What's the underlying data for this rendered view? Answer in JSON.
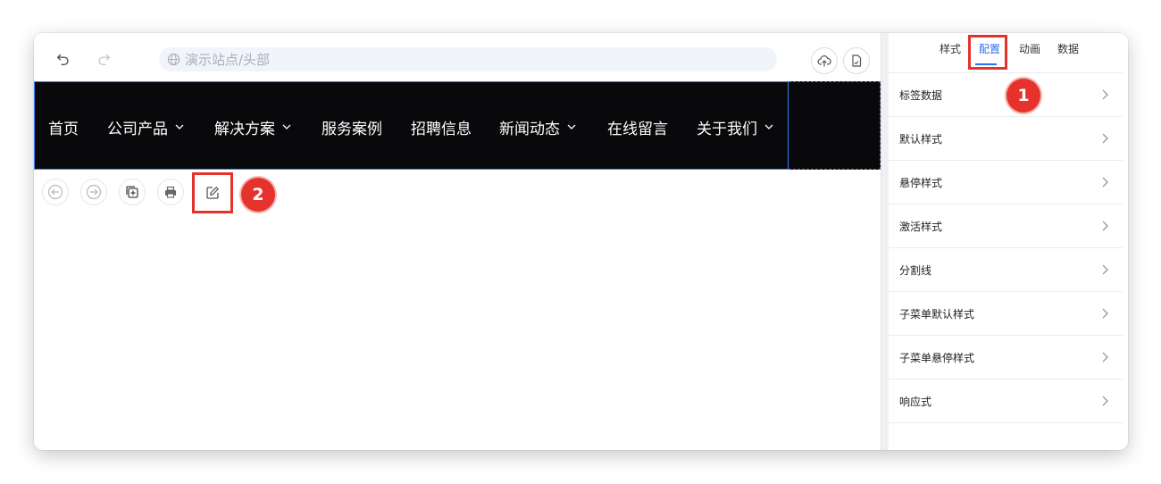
{
  "address_bar": {
    "text": "演示站点/头部"
  },
  "navbar": {
    "items": [
      {
        "label": "首页",
        "has_dropdown": false
      },
      {
        "label": "公司产品",
        "has_dropdown": true
      },
      {
        "label": "解决方案",
        "has_dropdown": true
      },
      {
        "label": "服务案例",
        "has_dropdown": false
      },
      {
        "label": "招聘信息",
        "has_dropdown": false
      },
      {
        "label": "新闻动态",
        "has_dropdown": true
      },
      {
        "label": "在线留言",
        "has_dropdown": false
      },
      {
        "label": "关于我们",
        "has_dropdown": true
      }
    ]
  },
  "panel": {
    "tabs": [
      {
        "label": "样式",
        "active": false
      },
      {
        "label": "配置",
        "active": true
      },
      {
        "label": "动画",
        "active": false
      },
      {
        "label": "数据",
        "active": false
      }
    ],
    "rows": [
      {
        "label": "标签数据"
      },
      {
        "label": "默认样式"
      },
      {
        "label": "悬停样式"
      },
      {
        "label": "激活样式"
      },
      {
        "label": "分割线"
      },
      {
        "label": "子菜单默认样式"
      },
      {
        "label": "子菜单悬停样式"
      },
      {
        "label": "响应式"
      }
    ]
  },
  "callouts": {
    "one": "1",
    "two": "2"
  },
  "colors": {
    "accent": "#2f6fed",
    "highlight": "#e5322d",
    "navbar_bg": "#09090b",
    "selection": "#3b82f6"
  }
}
